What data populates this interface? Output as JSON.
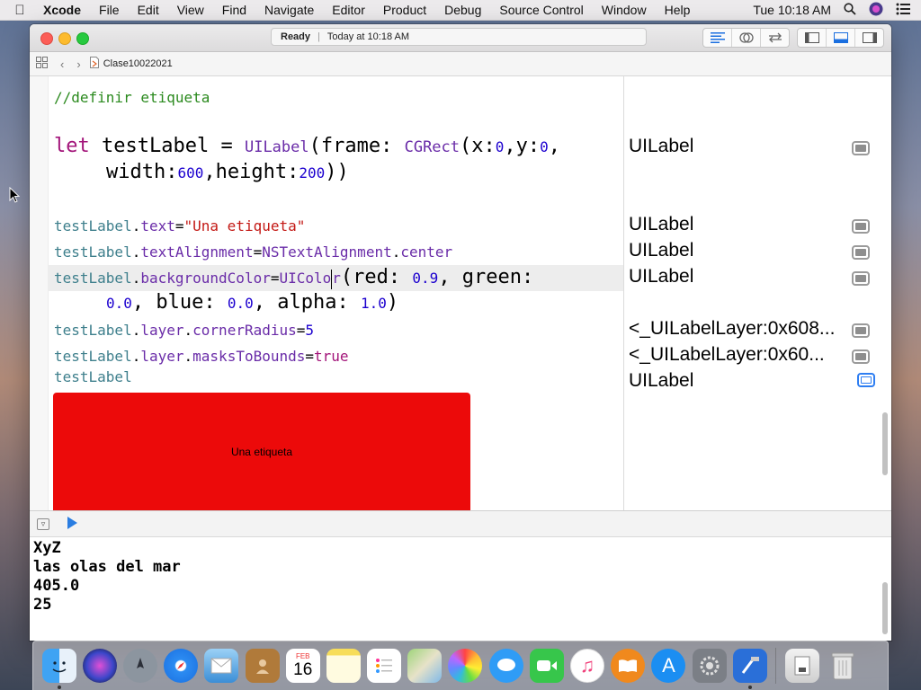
{
  "menubar": {
    "apple_icon": "apple-icon",
    "items": [
      "Xcode",
      "File",
      "Edit",
      "View",
      "Find",
      "Navigate",
      "Editor",
      "Product",
      "Debug",
      "Source Control",
      "Window",
      "Help"
    ],
    "clock": "Tue 10:18 AM"
  },
  "window": {
    "status_ready": "Ready",
    "status_time": "Today at 10:18 AM",
    "breadcrumb_file": "Clase10022021"
  },
  "code": {
    "comment": "//definir etiqueta",
    "l2": {
      "kw": "let",
      "name": "testLabel",
      "eq": " = ",
      "type": "UILabel",
      "p1": "(frame: ",
      "type2": "CGRect",
      "p2": "(x:",
      "n1": "0",
      "p3": ",y:",
      "n2": "0",
      "p4": ","
    },
    "l3": {
      "p1": "width:",
      "n1": "600",
      "p2": ",height:",
      "n2": "200",
      "p3": "))"
    },
    "l4": {
      "v": "testLabel",
      "d": ".",
      "prop": "text",
      "eq": "=",
      "str": "\"Una etiqueta\""
    },
    "l5": {
      "v": "testLabel",
      "d": ".",
      "prop": "textAlignment",
      "eq": "=",
      "type": "NSTextAlignment",
      "d2": ".",
      "val": "center"
    },
    "l6": {
      "v": "testLabel",
      "d": ".",
      "prop": "backgroundColor",
      "eq": "=",
      "type1": "UIColo",
      "type2": "r",
      "rest": "(red: ",
      "n1": "0.9",
      "rest2": ", green:"
    },
    "l7": {
      "n1": "0.0",
      "p1": ", blue: ",
      "n2": "0.0",
      "p2": ", alpha: ",
      "n3": "1.0",
      "p3": ")"
    },
    "l8": {
      "v": "testLabel",
      "d": ".",
      "prop": "layer",
      "d2": ".",
      "prop2": "cornerRadius",
      "eq": "=",
      "n": "5"
    },
    "l9": {
      "v": "testLabel",
      "d": ".",
      "prop": "layer",
      "d2": ".",
      "prop2": "masksToBounds",
      "eq": "=",
      "kw": "true"
    },
    "l10": {
      "v": "testLabel"
    },
    "label_preview_text": "Una etiqueta",
    "label_preview_color": "#ec0a0a"
  },
  "results": [
    "UILabel",
    "UILabel",
    "UILabel",
    "UILabel",
    "<_UILabelLayer:0x608...",
    "<_UILabelLayer:0x60...",
    "UILabel"
  ],
  "console": [
    "XyZ",
    "las olas del mar",
    "405.0",
    "25"
  ],
  "dock": [
    "finder",
    "siri",
    "launchpad",
    "safari",
    "mail",
    "contacts",
    "calendar",
    "notes",
    "reminders",
    "maps",
    "photos",
    "messages",
    "facetime",
    "itunes",
    "ibooks",
    "app-store",
    "system-preferences",
    "xcode",
    "downloads",
    "trash"
  ],
  "calendar_month": "FEB",
  "calendar_day": "16"
}
